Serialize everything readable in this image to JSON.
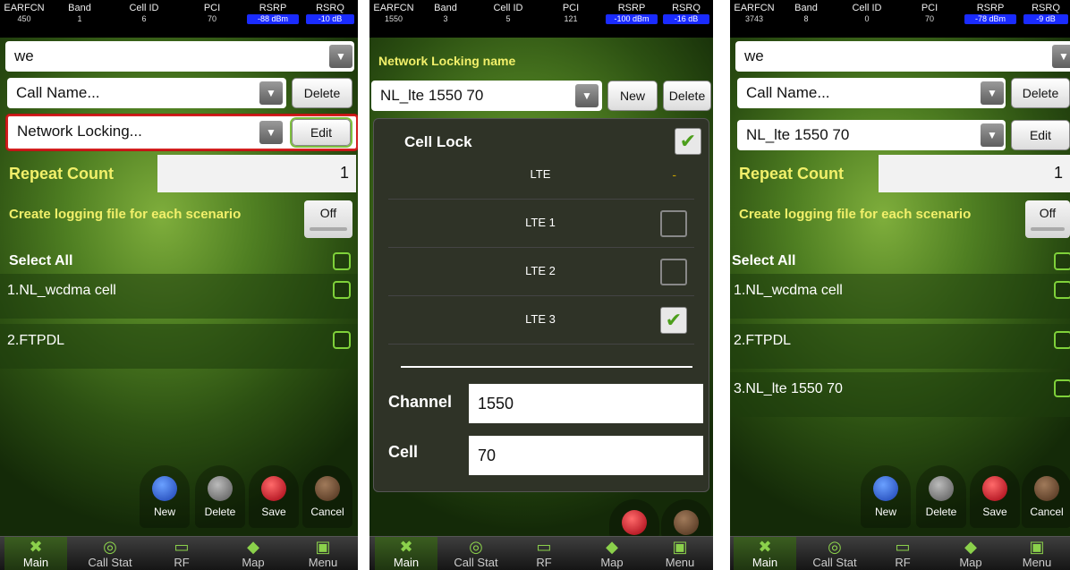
{
  "header_columns": [
    "EARFCN",
    "Band",
    "Cell ID",
    "PCI",
    "RSRP",
    "RSRQ"
  ],
  "screen1": {
    "status_values": [
      "450",
      "1",
      "6",
      "70",
      "-88 dBm",
      "-10 dB"
    ],
    "scenario_select": "we",
    "call_name_select": "Call Name...",
    "delete_label": "Delete",
    "network_locking_select": "Network Locking...",
    "edit_label": "Edit",
    "repeat_count_label": "Repeat Count",
    "repeat_count_value": "1",
    "logging_label": "Create logging file for each scenario",
    "logging_toggle": "Off",
    "select_all": "Select All",
    "items": [
      "1.NL_wcdma cell",
      "2.FTPDL"
    ],
    "actions": [
      "New",
      "Delete",
      "Save",
      "Cancel"
    ]
  },
  "screen2": {
    "status_values": [
      "1550",
      "3",
      "5",
      "121",
      "-100 dBm",
      "-16 dB"
    ],
    "title": "Network Locking name",
    "name_value": "NL_lte 1550 70",
    "new_label": "New",
    "delete_label": "Delete",
    "cell_lock_label": "Cell Lock",
    "lte_header": "LTE",
    "lte_header_value": "-",
    "lte_rows": [
      "LTE 1",
      "LTE 2",
      "LTE 3"
    ],
    "channel_label": "Channel",
    "channel_value": "1550",
    "cell_label": "Cell",
    "cell_value": "70"
  },
  "screen3": {
    "status_values": [
      "3743",
      "8",
      "0",
      "70",
      "-78 dBm",
      "-9 dB"
    ],
    "scenario_select": "we",
    "call_name_select": "Call Name...",
    "delete_label": "Delete",
    "network_locking_select": "NL_lte 1550 70",
    "edit_label": "Edit",
    "repeat_count_label": "Repeat Count",
    "repeat_count_value": "1",
    "logging_label": "Create logging file for each scenario",
    "logging_toggle": "Off",
    "select_all": "Select All",
    "items": [
      "1.NL_wcdma cell",
      "2.FTPDL",
      "3.NL_lte 1550 70"
    ],
    "actions": [
      "New",
      "Delete",
      "Save",
      "Cancel"
    ]
  },
  "nav": [
    "Main",
    "Call Stat",
    "RF",
    "Map",
    "Menu"
  ],
  "colors": {
    "accent_yellow": "#f2f06a",
    "check_green": "#7fd13a",
    "blue_badge": "#1a2bff",
    "highlight_red": "#d21f1f"
  }
}
